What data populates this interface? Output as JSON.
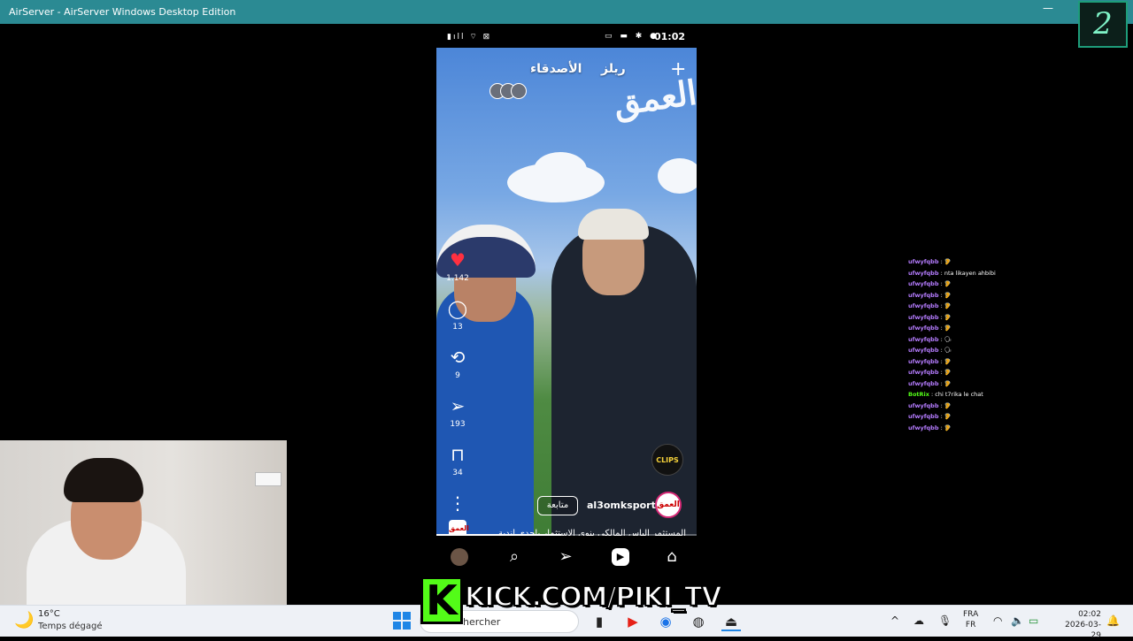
{
  "window": {
    "title": "AirServer - AirServer Windows Desktop Edition",
    "minimize_glyph": "—",
    "overlay_badge": "2"
  },
  "phone": {
    "status": {
      "time": "01:02",
      "left_icons": "▮ıll ⌔ ⊠",
      "right_icons": "▭ ▬ ✱ ●"
    },
    "top": {
      "reels_tab": "ريلز",
      "friends_tab": "الأصدقاء",
      "create_icon": "plus-icon"
    },
    "watermark": "العمق",
    "actions": [
      {
        "icon": "heart-icon",
        "glyph": "♥",
        "count": "1.142",
        "color": "#ff3040"
      },
      {
        "icon": "comment-icon",
        "glyph": "◯",
        "count": "13"
      },
      {
        "icon": "repost-icon",
        "glyph": "⟲",
        "count": "9"
      },
      {
        "icon": "share-icon",
        "glyph": "➢",
        "count": "193"
      },
      {
        "icon": "bookmark-icon",
        "glyph": "⊓",
        "count": "34"
      },
      {
        "icon": "more-icon",
        "glyph": "⋮",
        "count": ""
      }
    ],
    "clips_badge": "CLIPS",
    "follow_label": "متابعة",
    "username": "al3omksport",
    "profile_label": "العمق",
    "caption": "المستثمر إلياس المالكي ينوي الاستثمار بإحدى أندية ...",
    "caption_logo": "العمق",
    "progress": 0.48,
    "nav": [
      {
        "icon": "profile-avatar-icon",
        "glyph": ""
      },
      {
        "icon": "search-icon",
        "glyph": "⌕"
      },
      {
        "icon": "direct-message-icon",
        "glyph": "➢"
      },
      {
        "icon": "reels-icon",
        "glyph": "▶"
      },
      {
        "icon": "home-icon",
        "glyph": "⌂"
      }
    ]
  },
  "chat": [
    {
      "user": "ufwyfqbb",
      "msg": ": 🦻"
    },
    {
      "user": "ufwyfqbb",
      "msg": ": nta likayen ahbibi"
    },
    {
      "user": "ufwyfqbb",
      "msg": ": 🦻"
    },
    {
      "user": "ufwyfqbb",
      "msg": ": 🦻"
    },
    {
      "user": "ufwyfqbb",
      "msg": ": 🦻"
    },
    {
      "user": "ufwyfqbb",
      "msg": ": 🦻"
    },
    {
      "user": "ufwyfqbb",
      "msg": ": 🦻"
    },
    {
      "user": "ufwyfqbb",
      "msg": ": 🗣"
    },
    {
      "user": "ufwyfqbb",
      "msg": ": 🗣"
    },
    {
      "user": "ufwyfqbb",
      "msg": ": 🦻"
    },
    {
      "user": "ufwyfqbb",
      "msg": ": 🦻"
    },
    {
      "user": "ufwyfqbb",
      "msg": ": 🦻"
    },
    {
      "user": "BotRix",
      "msg": ": chi t7rika le chat",
      "bot": true
    },
    {
      "user": "ufwyfqbb",
      "msg": ": 🦻"
    },
    {
      "user": "ufwyfqbb",
      "msg": ": 🦻"
    },
    {
      "user": "ufwyfqbb",
      "msg": ": 🦻"
    }
  ],
  "kick": {
    "logo": "K",
    "url": "KICK.COM/PIKI_TV"
  },
  "taskbar": {
    "weather_temp": "16°C",
    "weather_desc": "Temps dégagé",
    "search_label": "hercher",
    "lang_top": "FRA",
    "lang_bottom": "FR",
    "time": "02:02",
    "date": "2026-03-29"
  },
  "colors": {
    "titlebar": "#2b8a93",
    "kick_green": "#53fc18",
    "chat_user": "#b57cff"
  }
}
